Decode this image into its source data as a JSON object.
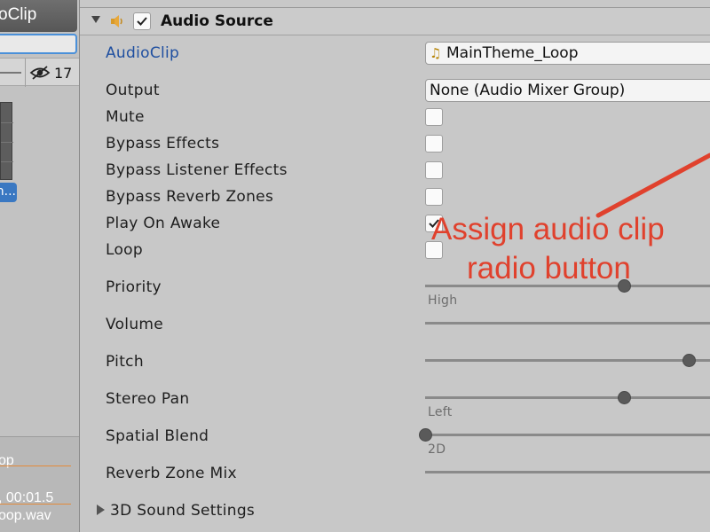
{
  "left_panel": {
    "title": "oClip",
    "hidden_count": "17",
    "selected_item": "n...",
    "clip_name": "op",
    "clip_info": ", 00:01.5",
    "clip_file": "oop.wav"
  },
  "component": {
    "title": "Audio Source",
    "enabled": true
  },
  "properties": {
    "audio_clip": {
      "label": "AudioClip",
      "value": "MainTheme_Loop",
      "icon": "music-note-icon"
    },
    "output": {
      "label": "Output",
      "value": "None (Audio Mixer Group)"
    },
    "mute": {
      "label": "Mute",
      "checked": false
    },
    "bypass_effects": {
      "label": "Bypass Effects",
      "checked": false
    },
    "bypass_listener_effects": {
      "label": "Bypass Listener Effects",
      "checked": false
    },
    "bypass_reverb_zones": {
      "label": "Bypass Reverb Zones",
      "checked": false
    },
    "play_on_awake": {
      "label": "Play On Awake",
      "checked": true
    },
    "loop": {
      "label": "Loop",
      "checked": false
    },
    "priority": {
      "label": "Priority",
      "slider_level": 0.68,
      "caption": "High"
    },
    "volume": {
      "label": "Volume"
    },
    "pitch": {
      "label": "Pitch",
      "slider_level": 0.9
    },
    "stereo_pan": {
      "label": "Stereo Pan",
      "slider_level": 0.68,
      "caption": "Left"
    },
    "spatial_blend": {
      "label": "Spatial Blend",
      "slider_level": 0.0,
      "caption": "2D"
    },
    "reverb_zone_mix": {
      "label": "Reverb Zone Mix"
    },
    "sound_3d_settings": {
      "label": "3D Sound Settings"
    }
  },
  "annotation": {
    "line1": "Assign audio clip",
    "line2": "radio button",
    "color": "#e0412d"
  },
  "colors": {
    "panel_bg": "#c8c8c8",
    "label_link": "#1f4fa0",
    "selection": "#3a78c2",
    "accent_orange": "#e38a3a"
  }
}
